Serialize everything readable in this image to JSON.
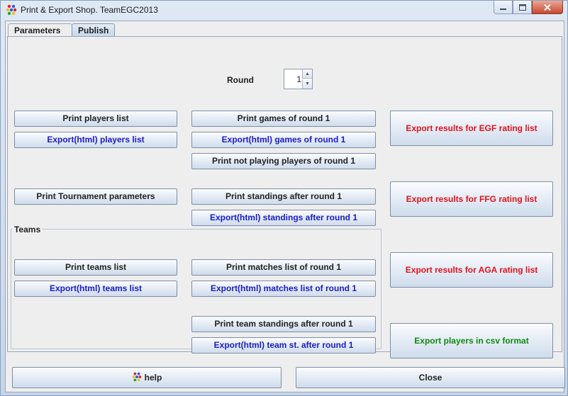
{
  "window": {
    "title": "Print & Export Shop. TeamEGC2013"
  },
  "tabs": [
    {
      "label": "Parameters"
    },
    {
      "label": "Publish"
    }
  ],
  "round": {
    "label": "Round",
    "value": "1"
  },
  "buttons": {
    "print_players": "Print players list",
    "export_players": "Export(html) players list",
    "print_games": "Print games of round 1",
    "export_games": "Export(html) games of round 1",
    "print_not_playing": "Print not playing players of round 1",
    "print_tournament_params": "Print Tournament parameters",
    "print_standings": "Print standings after round 1",
    "export_standings": "Export(html) standings after round 1",
    "export_egf": "Export results for EGF rating list",
    "export_ffg": "Export results for FFG rating list",
    "export_aga": "Export results for AGA rating list",
    "export_csv": "Export players in csv format"
  },
  "teams": {
    "title": "Teams",
    "print_teams": "Print teams list",
    "export_teams": "Export(html) teams list",
    "print_matches": "Print matches list of round 1",
    "export_matches": "Export(html) matches list of round 1",
    "print_team_standings": "Print team standings after round 1",
    "export_team_standings": "Export(html) team st. after round 1"
  },
  "footer": {
    "help_label": "help",
    "close_label": "Close"
  },
  "colors": {
    "blue_text": "#1b1bc8",
    "red_text": "#e3121a",
    "green_text": "#108a10"
  }
}
